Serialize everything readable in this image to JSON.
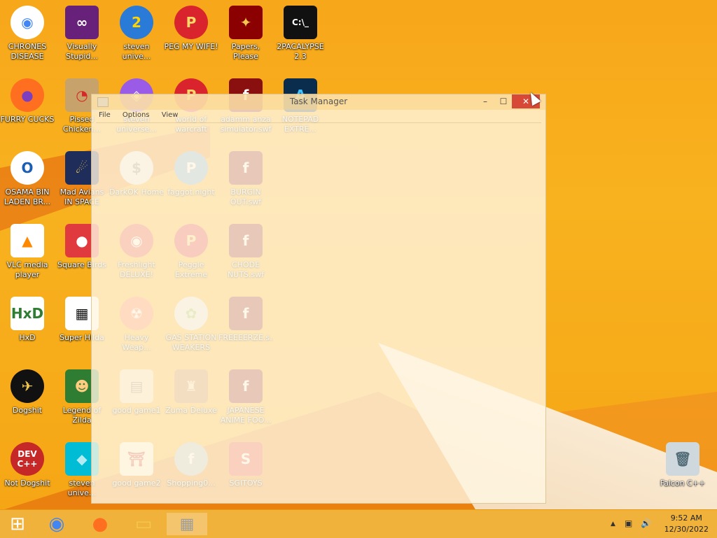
{
  "desktop": {
    "icons": [
      {
        "label": "CHRONES\nDISEASE",
        "glyph": "◉",
        "bg": "#ffffff",
        "fg": "#4285f4",
        "round": true
      },
      {
        "label": "Visually\nStupid...",
        "glyph": "∞",
        "bg": "#68217a",
        "fg": "#ffffff",
        "round": false
      },
      {
        "label": "steven\nunive...",
        "glyph": "2",
        "bg": "#2a7bd8",
        "fg": "#ffd400",
        "round": true
      },
      {
        "label": "PEG MY WIFE!",
        "glyph": "P",
        "bg": "#d9232d",
        "fg": "#ffd86a",
        "round": true
      },
      {
        "label": "Papers,\nPlease",
        "glyph": "✦",
        "bg": "#8b0000",
        "fg": "#f2c94c",
        "round": false
      },
      {
        "label": "2PACALYPSE\n2.3",
        "glyph": "C:\\_",
        "bg": "#111111",
        "fg": "#ffffff",
        "round": false
      },
      {
        "label": "FURRY CUCKS",
        "glyph": "●",
        "bg": "#ff6f1f",
        "fg": "#7b3fbf",
        "round": true
      },
      {
        "label": "Pissed\nChicken...",
        "glyph": "◔",
        "bg": "#c7a36b",
        "fg": "#d62828",
        "round": false
      },
      {
        "label": "steven\nuniverse...",
        "glyph": "◈",
        "bg": "#9a5ce6",
        "fg": "#ffffff",
        "round": true
      },
      {
        "label": "world of\nwarcraft",
        "glyph": "P",
        "bg": "#d9232d",
        "fg": "#ffd86a",
        "round": true
      },
      {
        "label": "adamm anza\nsimulator.swf",
        "glyph": "f",
        "bg": "#8a1010",
        "fg": "#ffffff",
        "round": false
      },
      {
        "label": "NOTEPAD\nEXTRE...",
        "glyph": "A",
        "bg": "#0a2d4d",
        "fg": "#40c0ff",
        "round": false
      },
      {
        "label": "OSAMA BIN\nLADEN BR...",
        "glyph": "O",
        "bg": "#ffffff",
        "fg": "#1a5fb4",
        "round": true
      },
      {
        "label": "Mad Avians\nIN SPACE",
        "glyph": "☄",
        "bg": "#1e2d5a",
        "fg": "#f2c94c",
        "round": false
      },
      {
        "label": "DarkOK Home",
        "glyph": "$",
        "bg": "#e8e8e8",
        "fg": "#888888",
        "round": true
      },
      {
        "label": "faggot.night",
        "glyph": "P",
        "bg": "#6fa8dc",
        "fg": "#ffffff",
        "round": true
      },
      {
        "label": "BURGIN\nOUT.swf",
        "glyph": "f",
        "bg": "#8a1010",
        "fg": "#ffffff",
        "round": false
      },
      {
        "label": "VLC media\nplayer",
        "glyph": "▲",
        "bg": "#ffffff",
        "fg": "#ff8800",
        "round": false
      },
      {
        "label": "Square Birds",
        "glyph": "●",
        "bg": "#e03a3e",
        "fg": "#ffffff",
        "round": false
      },
      {
        "label": "Freshlight\nDELUXE!",
        "glyph": "◉",
        "bg": "#e53935",
        "fg": "#ffffff",
        "round": true
      },
      {
        "label": "Peggle\nExtreme",
        "glyph": "P",
        "bg": "#d9232d",
        "fg": "#ffd86a",
        "round": true
      },
      {
        "label": "CHODE\nNUTS.swf",
        "glyph": "f",
        "bg": "#8a1010",
        "fg": "#ffffff",
        "round": false
      },
      {
        "label": "HxD",
        "glyph": "HxD",
        "bg": "#ffffff",
        "fg": "#2e7d32",
        "round": false
      },
      {
        "label": "Super Hilda",
        "glyph": "▦",
        "bg": "#ffffff",
        "fg": "#111111",
        "round": false
      },
      {
        "label": "Heavy\nWeap...",
        "glyph": "☢",
        "bg": "#ff7043",
        "fg": "#ffffff",
        "round": true
      },
      {
        "label": "GAS STATION\nWEAKERS",
        "glyph": "✿",
        "bg": "#e6e6e6",
        "fg": "#8bc34a",
        "round": true
      },
      {
        "label": "FREEEERZE.s...",
        "glyph": "f",
        "bg": "#8a1010",
        "fg": "#ffffff",
        "round": false
      },
      {
        "label": "Dogshit",
        "glyph": "✈",
        "bg": "#111111",
        "fg": "#f2c94c",
        "round": true
      },
      {
        "label": "Legend of\nZilda",
        "glyph": "☻",
        "bg": "#2e7d32",
        "fg": "#ffcc80",
        "round": false
      },
      {
        "label": "good game1",
        "glyph": "▤",
        "bg": "#f5deb3",
        "fg": "#8d6e63",
        "round": false
      },
      {
        "label": "Zuma Deluxe",
        "glyph": "♜",
        "bg": "#c67c3c",
        "fg": "#ffe0b2",
        "round": false
      },
      {
        "label": "JAPANESE\nANIME FOO...",
        "glyph": "f",
        "bg": "#8a1010",
        "fg": "#ffffff",
        "round": false
      },
      {
        "label": "Not Dogshit",
        "glyph": "DEV\nC++",
        "bg": "#c62828",
        "fg": "#ffffff",
        "round": true
      },
      {
        "label": "steven\nunive...",
        "glyph": "◆",
        "bg": "#00bcd4",
        "fg": "#b2ebf2",
        "round": false
      },
      {
        "label": "good game2",
        "glyph": "⛩",
        "bg": "#fff3e0",
        "fg": "#c62828",
        "round": false
      },
      {
        "label": "Shopping0...",
        "glyph": "f",
        "bg": "#b0bec5",
        "fg": "#ffffff",
        "round": true
      },
      {
        "label": "SGITOYS",
        "glyph": "S",
        "bg": "#e53935",
        "fg": "#ffffff",
        "round": false
      },
      {
        "label": "Falcon C++",
        "glyph": "🗑",
        "bg": "#cfd8dc",
        "fg": "#546e7a",
        "round": false
      }
    ]
  },
  "task_manager": {
    "title": "Task Manager",
    "menu": [
      "File",
      "Options",
      "View"
    ],
    "minimize": "–",
    "maximize": "☐",
    "close": "✕"
  },
  "taskbar": {
    "start_glyph": "⊞",
    "apps": [
      {
        "name": "chrome",
        "glyph": "◉",
        "fg": "#4285f4"
      },
      {
        "name": "firefox",
        "glyph": "●",
        "fg": "#ff6f1f"
      },
      {
        "name": "file-explorer",
        "glyph": "▭",
        "fg": "#f2c94c"
      },
      {
        "name": "task-manager",
        "glyph": "▦",
        "fg": "#9e9e9e"
      }
    ],
    "tray": {
      "chevron": "▲",
      "network": "▣",
      "volume": "🔊"
    },
    "clock": {
      "time": "9:52 AM",
      "date": "12/30/2022"
    }
  }
}
